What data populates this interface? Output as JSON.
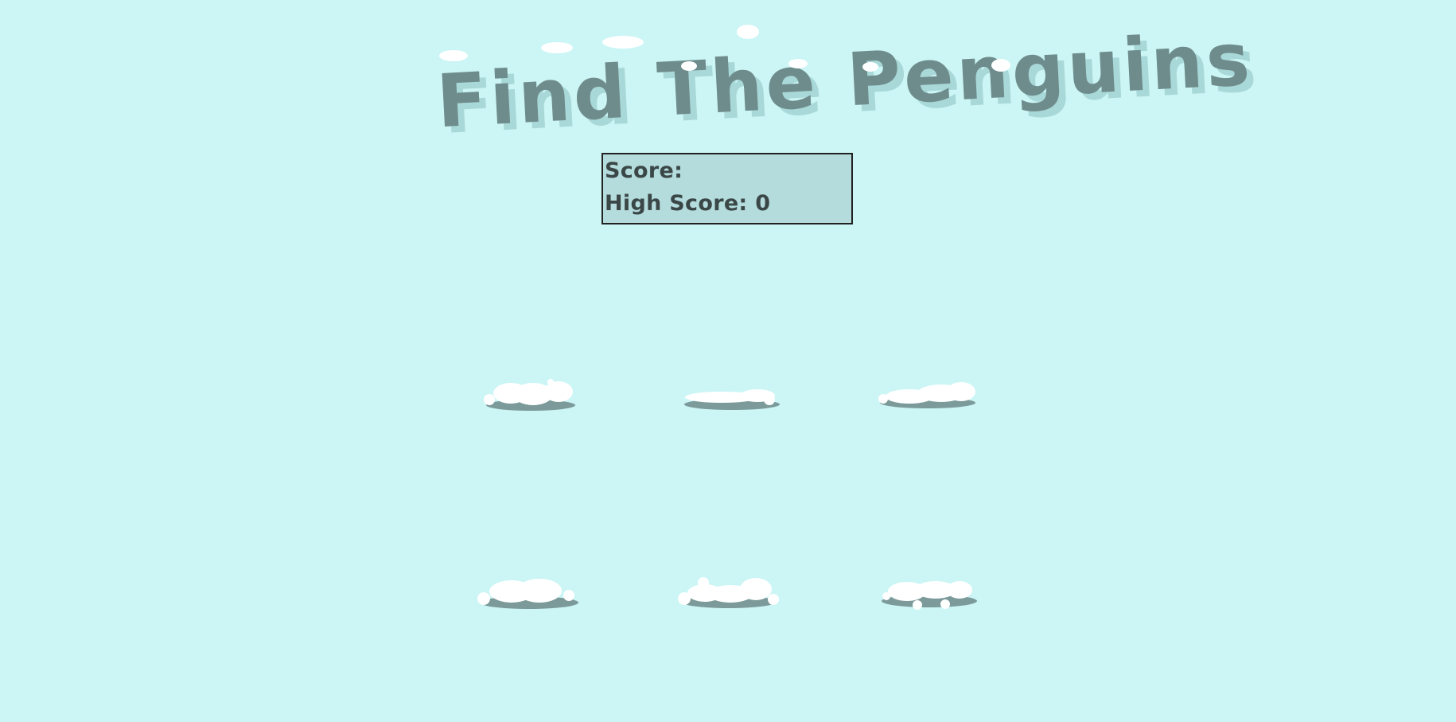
{
  "game": {
    "title": "Find The Penguins"
  },
  "scoreboard": {
    "score_label": "Score:",
    "score_value": "",
    "high_score_label": "High Score:",
    "high_score_value": "0"
  },
  "colors": {
    "background": "#ccf5f5",
    "title_fill": "#6f8c8c",
    "title_shadow": "#a9d8d8",
    "snow": "#ffffff",
    "scoreboard_bg": "#b4dcdc",
    "scoreboard_text": "#3b4747",
    "hole_shadow": "#7c9a9a"
  },
  "holes": [
    {
      "id": "hole-1",
      "row": 1,
      "col": 1
    },
    {
      "id": "hole-2",
      "row": 1,
      "col": 2
    },
    {
      "id": "hole-3",
      "row": 1,
      "col": 3
    },
    {
      "id": "hole-4",
      "row": 2,
      "col": 1
    },
    {
      "id": "hole-5",
      "row": 2,
      "col": 2
    },
    {
      "id": "hole-6",
      "row": 2,
      "col": 3
    }
  ]
}
